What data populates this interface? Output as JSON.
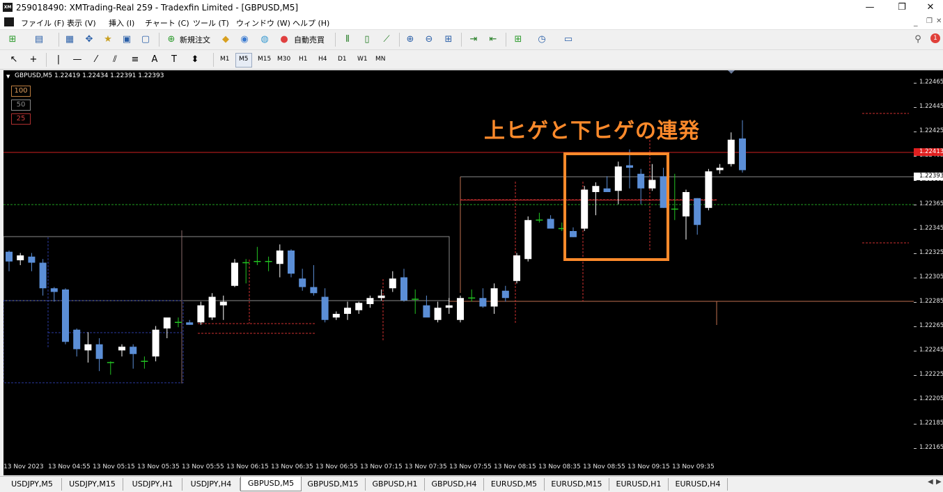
{
  "window": {
    "title": "259018490: XMTrading-Real 259 - Tradexfin Limited - [GBPUSD,M5]",
    "app_icon_text": "XM",
    "minimize": "—",
    "maximize": "❐",
    "close": "✕"
  },
  "menu": [
    "ファイル (F)",
    "表示 (V)",
    "挿入 (I)",
    "チャート (C)",
    "ツール (T)",
    "ウィンドウ (W)",
    "ヘルプ (H)"
  ],
  "toolbar": {
    "new_order_label": "新規注文",
    "auto_trade_label": "自動売買"
  },
  "timeframes": [
    "M1",
    "M5",
    "M15",
    "M30",
    "H1",
    "H4",
    "D1",
    "W1",
    "MN"
  ],
  "active_timeframe": "M5",
  "chart": {
    "symbol_info": "GBPUSD,M5  1.22419 1.22434 1.22391 1.22393",
    "levels": [
      "100",
      "50",
      "25"
    ],
    "annotation": "上ヒゲと下ヒゲの連発",
    "current_price_label": "1.22413",
    "bid_label": "1.22393"
  },
  "price_axis": [
    "1.22465",
    "1.22445",
    "1.22425",
    "1.22405",
    "1.22385",
    "1.22365",
    "1.22345",
    "1.22325",
    "1.22305",
    "1.22285",
    "1.22265",
    "1.22245",
    "1.22225",
    "1.22205",
    "1.22185",
    "1.22165"
  ],
  "time_axis": [
    "13 Nov 2023",
    "13 Nov 04:55",
    "13 Nov 05:15",
    "13 Nov 05:35",
    "13 Nov 05:55",
    "13 Nov 06:15",
    "13 Nov 06:35",
    "13 Nov 06:55",
    "13 Nov 07:15",
    "13 Nov 07:35",
    "13 Nov 07:55",
    "13 Nov 08:15",
    "13 Nov 08:35",
    "13 Nov 08:55",
    "13 Nov 09:15",
    "13 Nov 09:35"
  ],
  "tabs": [
    "USDJPY,M5",
    "USDJPY,M15",
    "USDJPY,H1",
    "USDJPY,H4",
    "GBPUSD,M5",
    "GBPUSD,M15",
    "GBPUSD,H1",
    "GBPUSD,H4",
    "EURUSD,M5",
    "EURUSD,M15",
    "EURUSD,H1",
    "EURUSD,H4"
  ],
  "active_tab": "GBPUSD,M5",
  "colors": {
    "bull": "#ffffff",
    "bear": "#5b8ed6",
    "doji": "#22c422",
    "annotation": "#ff8a2b",
    "current_price_line": "#e02020"
  },
  "chart_data": {
    "type": "candlestick",
    "ylim": [
      1.22155,
      1.22475
    ],
    "candles": [
      [
        1.22326,
        1.22327,
        1.2231,
        1.22318
      ],
      [
        1.22319,
        1.22325,
        1.22315,
        1.22323
      ],
      [
        1.22322,
        1.22325,
        1.2231,
        1.22317
      ],
      [
        1.22317,
        1.2232,
        1.2229,
        1.22296
      ],
      [
        1.22296,
        1.22297,
        1.22285,
        1.22293
      ],
      [
        1.22295,
        1.22296,
        1.2225,
        1.22252
      ],
      [
        1.22262,
        1.22263,
        1.2224,
        1.22246
      ],
      [
        1.22245,
        1.2226,
        1.22235,
        1.2225
      ],
      [
        1.2225,
        1.22255,
        1.22228,
        1.22238
      ],
      [
        1.22235,
        1.22236,
        1.22225,
        1.22235
      ],
      [
        1.22245,
        1.2225,
        1.2224,
        1.22248
      ],
      [
        1.22248,
        1.2225,
        1.2223,
        1.22242
      ],
      [
        1.22236,
        1.2224,
        1.2223,
        1.22236
      ],
      [
        1.2224,
        1.22265,
        1.22236,
        1.22262
      ],
      [
        1.22263,
        1.2227,
        1.22255,
        1.22272
      ],
      [
        1.22267,
        1.22272,
        1.22264,
        1.22268
      ],
      [
        1.22268,
        1.2227,
        1.22266,
        1.22266
      ],
      [
        1.22268,
        1.22285,
        1.22266,
        1.22282
      ],
      [
        1.22272,
        1.22292,
        1.2227,
        1.22289
      ],
      [
        1.22282,
        1.2229,
        1.2227,
        1.22285
      ],
      [
        1.22298,
        1.2232,
        1.22297,
        1.22317
      ],
      [
        1.22317,
        1.2232,
        1.223,
        1.22317
      ],
      [
        1.22318,
        1.2233,
        1.22315,
        1.22318
      ],
      [
        1.22318,
        1.22322,
        1.2231,
        1.22318
      ],
      [
        1.22316,
        1.22332,
        1.22305,
        1.22327
      ],
      [
        1.22327,
        1.22328,
        1.22305,
        1.22308
      ],
      [
        1.22304,
        1.22312,
        1.22294,
        1.22297
      ],
      [
        1.22297,
        1.22315,
        1.2229,
        1.22292
      ],
      [
        1.22289,
        1.22296,
        1.22268,
        1.2227
      ],
      [
        1.22272,
        1.22277,
        1.2227,
        1.22275
      ],
      [
        1.22275,
        1.22285,
        1.2227,
        1.2228
      ],
      [
        1.22278,
        1.22285,
        1.22275,
        1.22284
      ],
      [
        1.22283,
        1.2229,
        1.2228,
        1.22288
      ],
      [
        1.22288,
        1.22295,
        1.22286,
        1.2229
      ],
      [
        1.22296,
        1.2231,
        1.22293,
        1.22304
      ],
      [
        1.22305,
        1.22312,
        1.22285,
        1.22286
      ],
      [
        1.22287,
        1.22295,
        1.22275,
        1.22287
      ],
      [
        1.22282,
        1.2229,
        1.22278,
        1.22272
      ],
      [
        1.2227,
        1.22285,
        1.22268,
        1.2228
      ],
      [
        1.2228,
        1.22288,
        1.22275,
        1.22282
      ],
      [
        1.2227,
        1.2229,
        1.22268,
        1.22288
      ],
      [
        1.22288,
        1.22295,
        1.22285,
        1.22287
      ],
      [
        1.22288,
        1.22296,
        1.2228,
        1.22281
      ],
      [
        1.22281,
        1.223,
        1.22275,
        1.22296
      ],
      [
        1.22294,
        1.22298,
        1.22285,
        1.22288
      ],
      [
        1.22302,
        1.22325,
        1.223,
        1.22323
      ],
      [
        1.2232,
        1.22355,
        1.22318,
        1.22352
      ],
      [
        1.22352,
        1.22358,
        1.2235,
        1.22352
      ],
      [
        1.22353,
        1.22356,
        1.22345,
        1.22345
      ],
      [
        1.22345,
        1.2235,
        1.22343,
        1.22345
      ],
      [
        1.22343,
        1.22346,
        1.22338,
        1.22338
      ],
      [
        1.22345,
        1.2238,
        1.22343,
        1.22377
      ],
      [
        1.22375,
        1.22383,
        1.22356,
        1.2238
      ],
      [
        1.22378,
        1.22388,
        1.22378,
        1.22375
      ],
      [
        1.22376,
        1.224,
        1.22365,
        1.22396
      ],
      [
        1.22397,
        1.2241,
        1.22378,
        1.22395
      ],
      [
        1.2239,
        1.22394,
        1.22365,
        1.22378
      ],
      [
        1.22378,
        1.22398,
        1.22376,
        1.22385
      ],
      [
        1.22388,
        1.22395,
        1.22362,
        1.22362
      ],
      [
        1.2236,
        1.2239,
        1.22352,
        1.22361
      ],
      [
        1.22355,
        1.22377,
        1.22336,
        1.22375
      ],
      [
        1.2237,
        1.2237,
        1.2234,
        1.22348
      ],
      [
        1.22362,
        1.22394,
        1.2236,
        1.22392
      ],
      [
        1.22393,
        1.22398,
        1.2239,
        1.22395
      ],
      [
        1.22398,
        1.22424,
        1.22396,
        1.22418
      ],
      [
        1.22419,
        1.22434,
        1.22391,
        1.22393
      ]
    ],
    "current_price": 1.22413,
    "bid": 1.22393
  }
}
